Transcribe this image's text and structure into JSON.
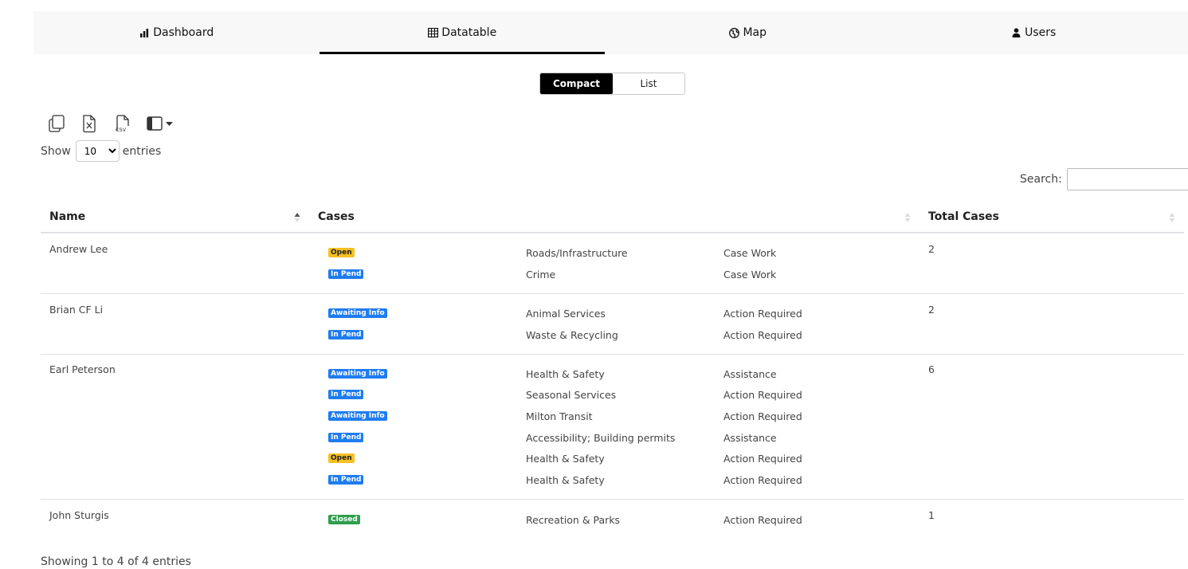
{
  "nav": {
    "tabs": [
      {
        "label": "Dashboard",
        "icon": "bar-chart-icon",
        "active": false
      },
      {
        "label": "Datatable",
        "icon": "table-icon",
        "active": true
      },
      {
        "label": "Map",
        "icon": "globe-icon",
        "active": false
      },
      {
        "label": "Users",
        "icon": "user-icon",
        "active": false
      }
    ]
  },
  "view_toggle": {
    "compact": "Compact",
    "list": "List",
    "selected": "Compact"
  },
  "toolbar": {
    "icons": [
      "copy-icon",
      "excel-icon",
      "csv-icon",
      "column-visibility-icon"
    ]
  },
  "length": {
    "show": "Show",
    "value": "10",
    "entries": "entries"
  },
  "search": {
    "label": "Search:",
    "value": ""
  },
  "table": {
    "headers": {
      "name": "Name",
      "cases": "Cases",
      "total": "Total Cases"
    },
    "rows": [
      {
        "name": "Andrew Lee",
        "total": "2",
        "cases": [
          {
            "status": "Open",
            "category": "Roads/Infrastructure",
            "type": "Case Work"
          },
          {
            "status": "In Pend",
            "category": "Crime",
            "type": "Case Work"
          }
        ]
      },
      {
        "name": "Brian CF Li",
        "total": "2",
        "cases": [
          {
            "status": "Awaiting Info",
            "category": "Animal Services",
            "type": "Action Required"
          },
          {
            "status": "In Pend",
            "category": "Waste & Recycling",
            "type": "Action Required"
          }
        ]
      },
      {
        "name": "Earl Peterson",
        "total": "6",
        "cases": [
          {
            "status": "Awaiting Info",
            "category": "Health & Safety",
            "type": "Assistance"
          },
          {
            "status": "In Pend",
            "category": "Seasonal Services",
            "type": "Action Required"
          },
          {
            "status": "Awaiting Info",
            "category": "Milton Transit",
            "type": "Action Required"
          },
          {
            "status": "In Pend",
            "category": "Accessibility; Building permits",
            "type": "Assistance"
          },
          {
            "status": "Open",
            "category": "Health & Safety",
            "type": "Action Required"
          },
          {
            "status": "In Pend",
            "category": "Health & Safety",
            "type": "Action Required"
          }
        ]
      },
      {
        "name": "John Sturgis",
        "total": "1",
        "cases": [
          {
            "status": "Closed",
            "category": "Recreation & Parks",
            "type": "Action Required"
          }
        ]
      }
    ]
  },
  "info": "Showing 1 to 4 of 4 entries",
  "colors": {
    "open": "#f5c022",
    "in_pend": "#1f7cf0",
    "awaiting": "#1f7cf0",
    "closed": "#2f9e4e",
    "accent": "#000000"
  }
}
